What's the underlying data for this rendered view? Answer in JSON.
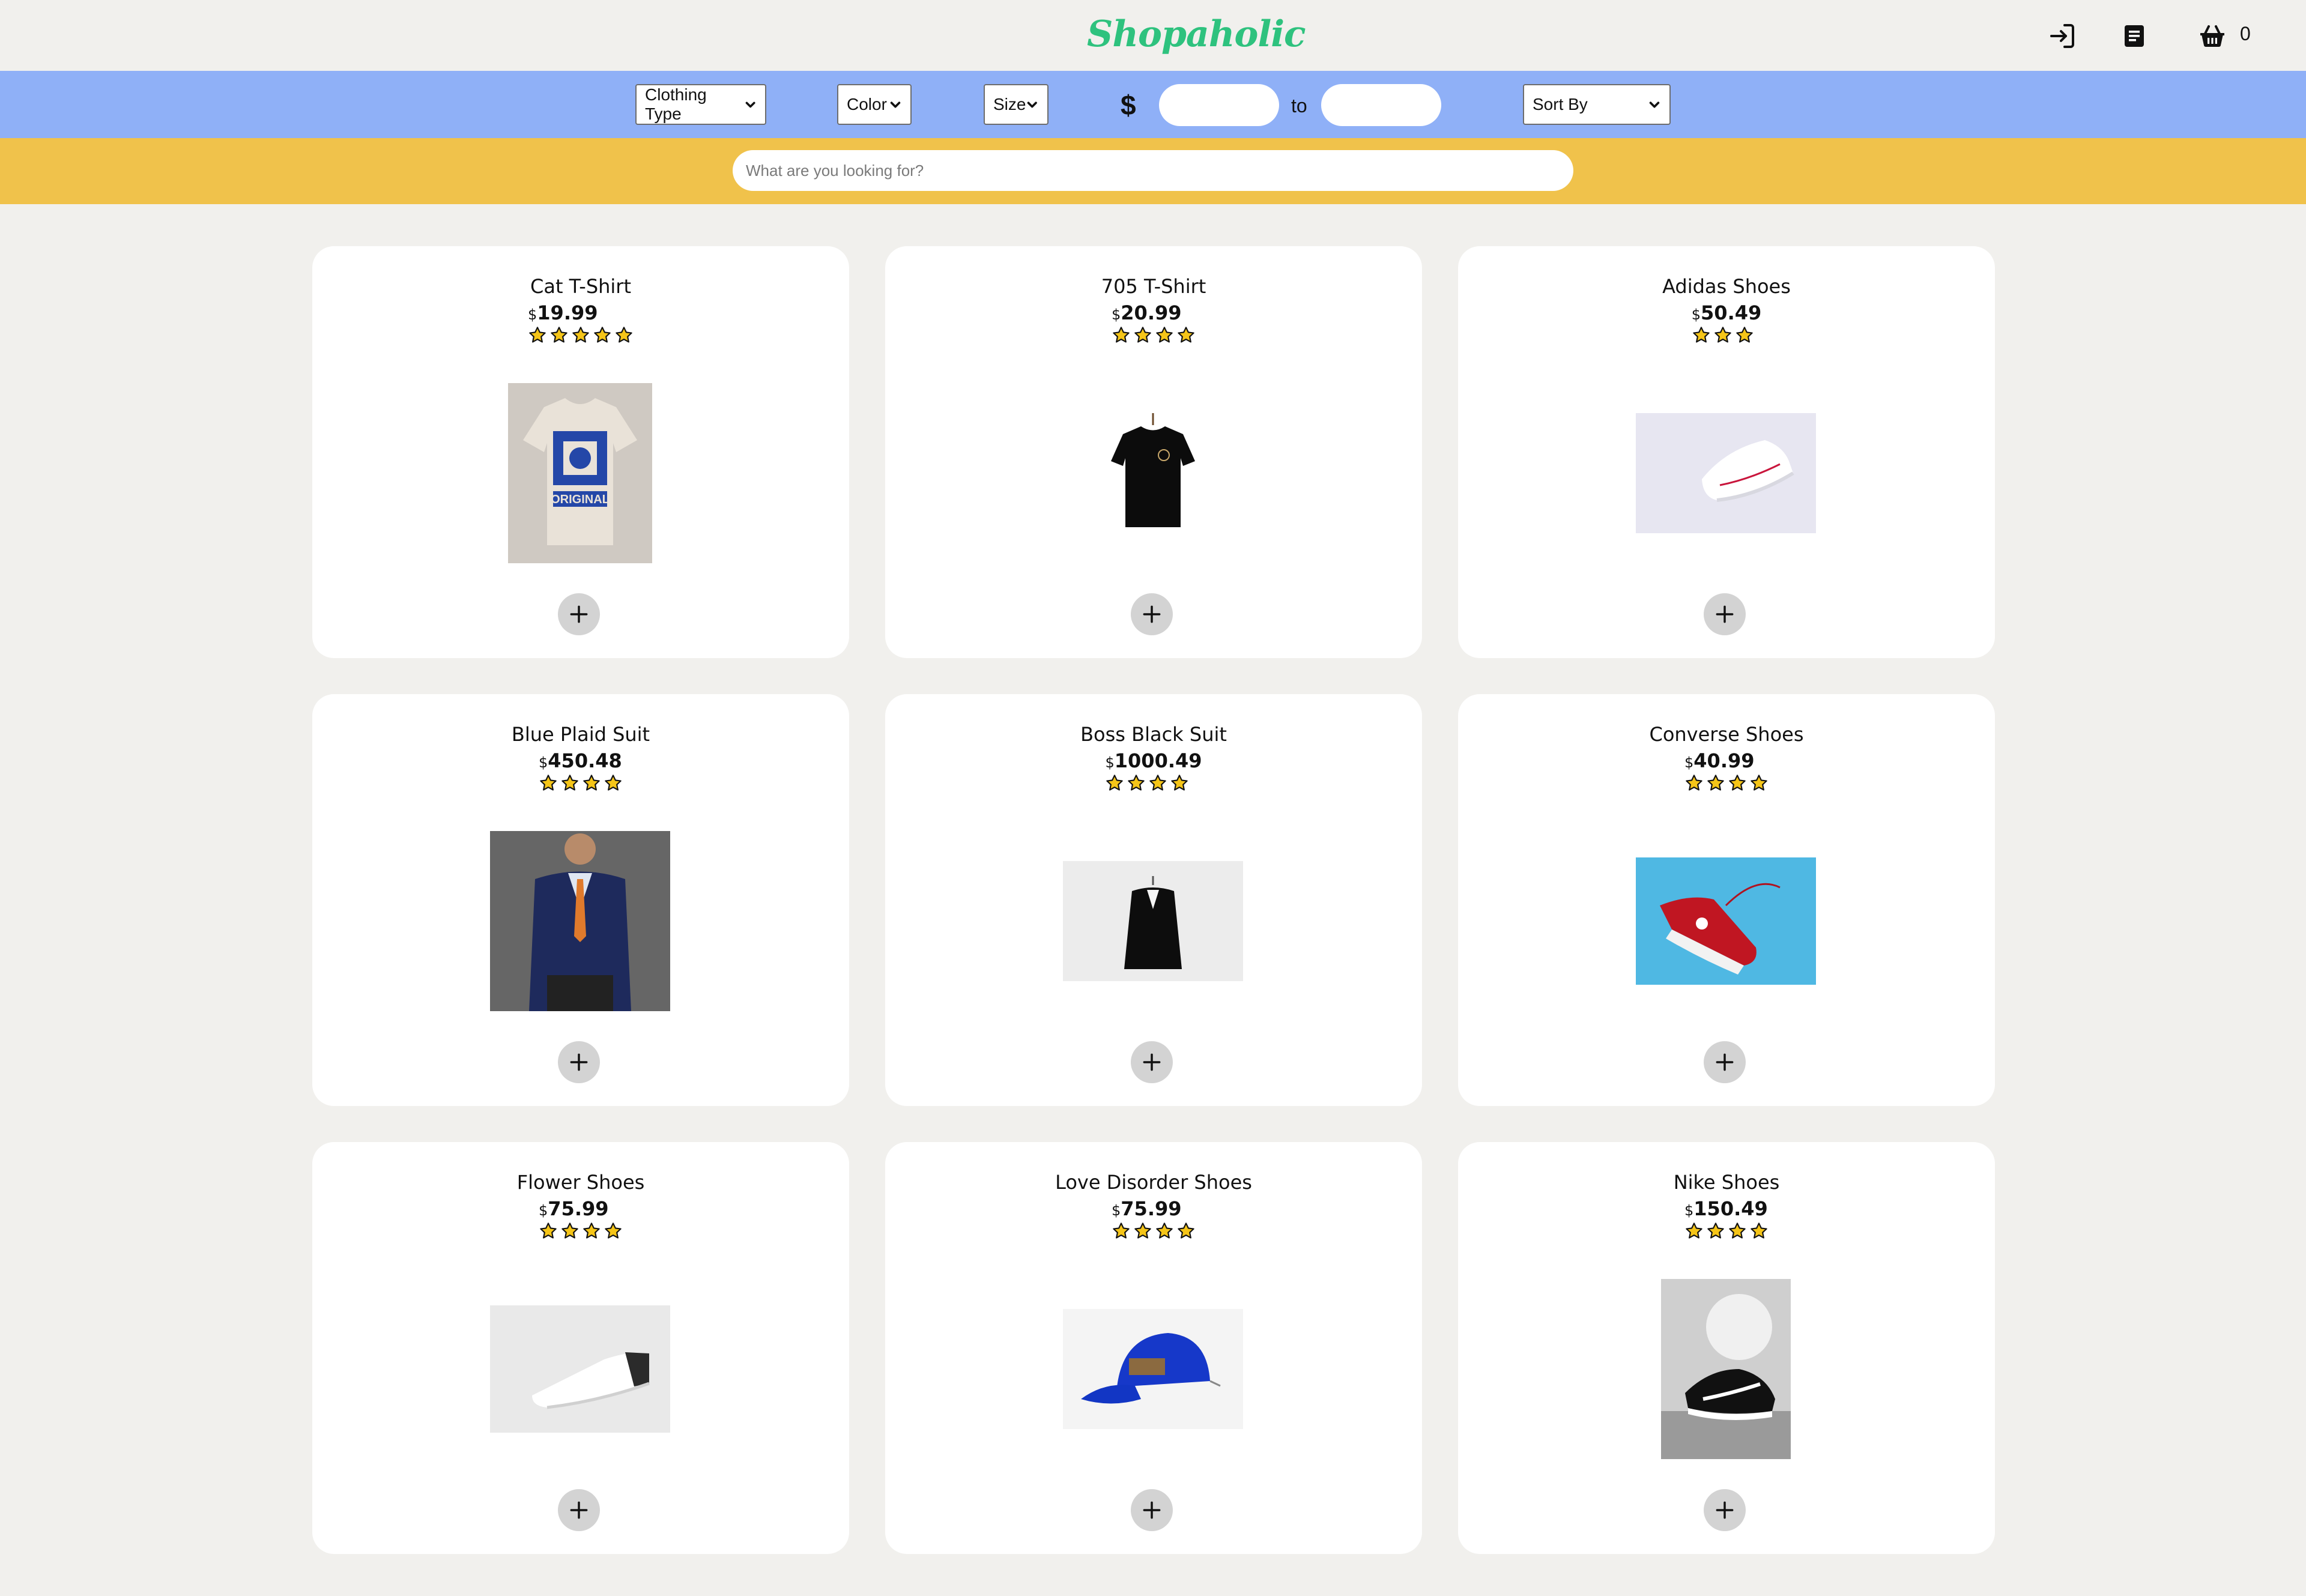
{
  "header": {
    "logo": "Shopaholic",
    "login_icon": "login-icon",
    "orders_icon": "receipt-icon",
    "cart_icon": "basket-icon",
    "cart_count": "0"
  },
  "filters": {
    "clothing_type": "Clothing Type",
    "color": "Color",
    "size": "Size",
    "currency": "$",
    "to": "to",
    "sort_by": "Sort By"
  },
  "search": {
    "placeholder": "What are you looking for?"
  },
  "colors": {
    "background": "#f1f0ed",
    "filter_bar": "#8fb0f7",
    "search_bar": "#f0c24b",
    "logo": "#2ec27e",
    "star_fill": "#f5c518"
  },
  "products": [
    {
      "name": "Cat T-Shirt",
      "currency": "$",
      "price": "19.99",
      "rating": 5
    },
    {
      "name": "705 T-Shirt",
      "currency": "$",
      "price": "20.99",
      "rating": 4
    },
    {
      "name": "Adidas Shoes",
      "currency": "$",
      "price": "50.49",
      "rating": 3
    },
    {
      "name": "Blue Plaid Suit",
      "currency": "$",
      "price": "450.48",
      "rating": 4
    },
    {
      "name": "Boss Black Suit",
      "currency": "$",
      "price": "1000.49",
      "rating": 4
    },
    {
      "name": "Converse Shoes",
      "currency": "$",
      "price": "40.99",
      "rating": 4
    },
    {
      "name": "Flower Shoes",
      "currency": "$",
      "price": "75.99",
      "rating": 4
    },
    {
      "name": "Love Disorder Shoes",
      "currency": "$",
      "price": "75.99",
      "rating": 4
    },
    {
      "name": "Nike Shoes",
      "currency": "$",
      "price": "150.49",
      "rating": 4
    }
  ]
}
